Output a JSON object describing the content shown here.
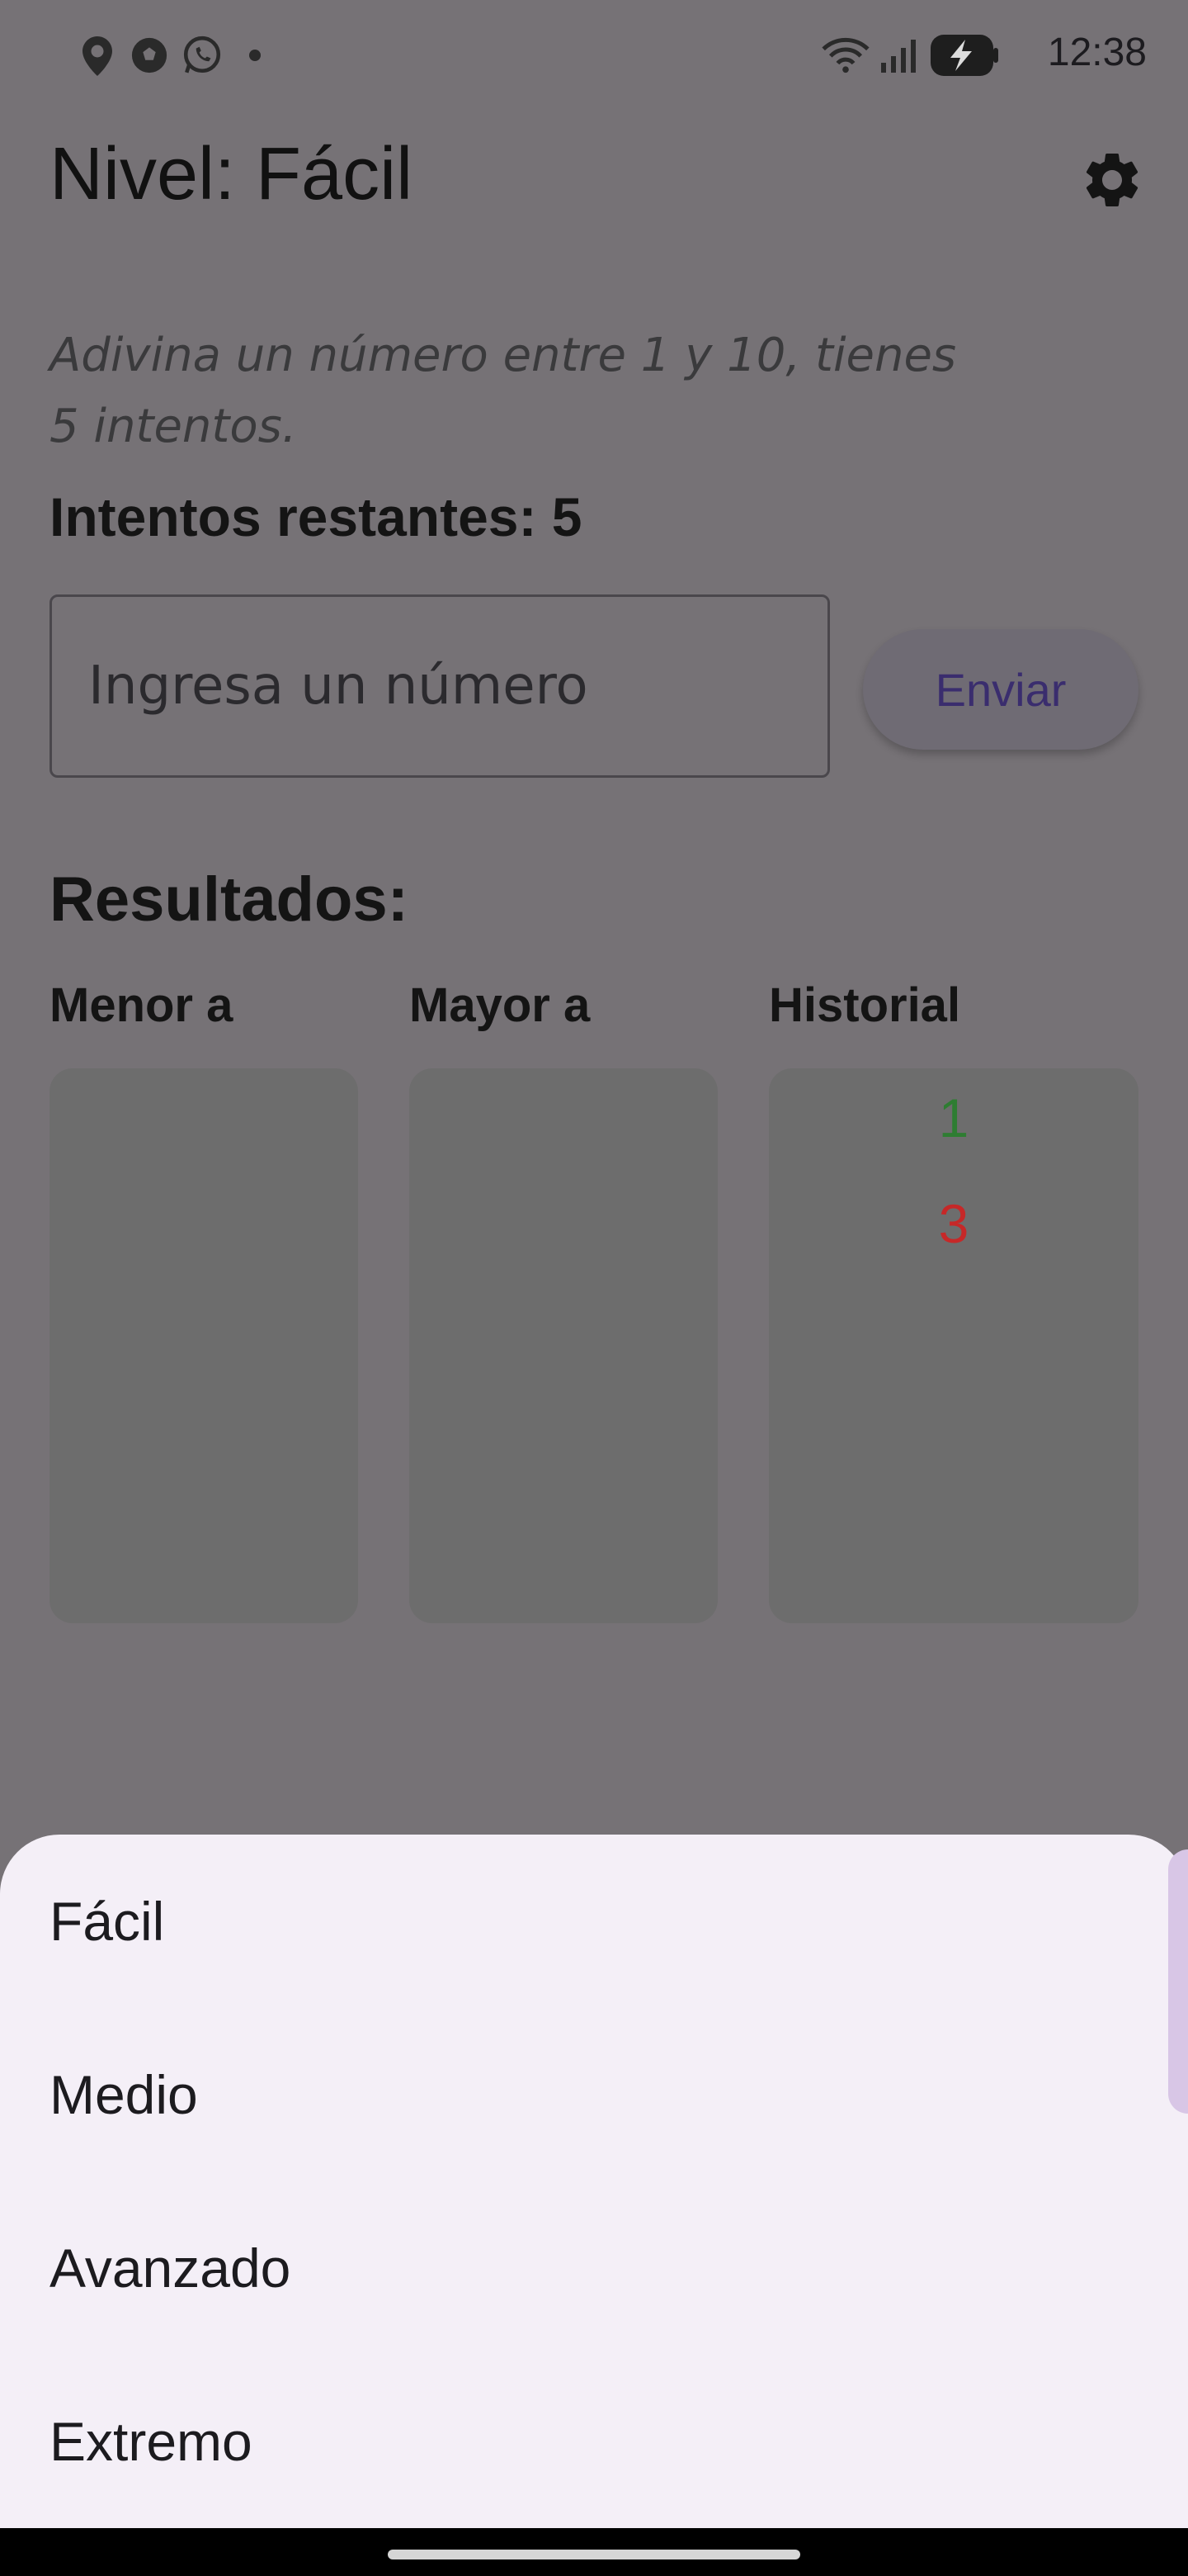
{
  "status_bar": {
    "time": "12:38",
    "left_icons": [
      "location-pin-icon",
      "soccer-ball-icon",
      "whatsapp-icon",
      "notification-dot-icon"
    ],
    "right_icons": [
      "wifi-icon",
      "signal-icon",
      "battery-charging-icon"
    ]
  },
  "app_bar": {
    "title": "Nivel: Fácil",
    "settings_icon": "gear-icon"
  },
  "game": {
    "instructions": "Adivina un número entre 1 y 10, tienes 5 intentos.",
    "remaining_attempts": "Intentos restantes: 5",
    "input_placeholder": "Ingresa un número",
    "input_value": "",
    "send_label": "Enviar"
  },
  "results": {
    "title": "Resultados:",
    "columns": {
      "lower": "Menor a",
      "higher": "Mayor a",
      "history": "Historial"
    },
    "lower_values": [],
    "higher_values": [],
    "history": [
      {
        "value": "1",
        "color": "#2e7d32"
      },
      {
        "value": "3",
        "color": "#c62828"
      }
    ]
  },
  "level_sheet": {
    "options": [
      "Fácil",
      "Medio",
      "Avanzado",
      "Extremo"
    ]
  }
}
